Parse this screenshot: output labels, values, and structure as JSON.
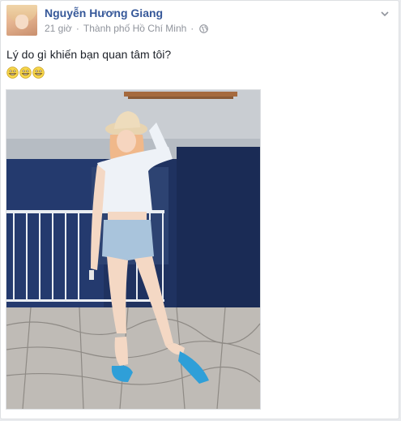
{
  "post": {
    "author_name": "Nguyễn Hương Giang",
    "timestamp": "21 giờ",
    "separator": "·",
    "location": "Thành phố Hồ Chí Minh",
    "text": "Lý do gì khiến bạn quan tâm tôi?",
    "emojis": [
      "grinning-face-icon",
      "grinning-face-icon",
      "grinning-face-icon"
    ],
    "privacy_icon": "globe-icon",
    "options_icon": "chevron-down-icon"
  },
  "colors": {
    "author_link": "#365899",
    "meta_text": "#90949c",
    "body_text": "#1d2129",
    "card_border": "#dddfe2",
    "background": "#e9ebee"
  }
}
